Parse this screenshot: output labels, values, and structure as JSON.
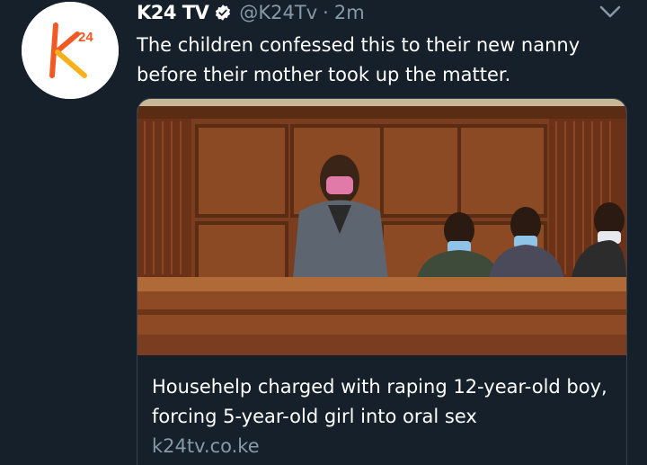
{
  "tweet": {
    "display_name": "K24 TV",
    "handle": "@K24Tv",
    "separator": "·",
    "time": "2m",
    "text": "The children confessed this to their new nanny\nbefore their mother took up the matter.",
    "avatar_logo_text": "k24",
    "icons": {
      "verified": "verified-badge-icon",
      "caret": "chevron-down-icon"
    }
  },
  "card": {
    "title": "Househelp charged with raping 12-year-old boy, forcing 5-year-old girl into oral sex",
    "domain": "k24tv.co.ke",
    "image_description_icon": "courtroom-photo"
  },
  "colors": {
    "background": "#15202b",
    "secondary_text": "#8899a6",
    "border": "#38444d",
    "brand_orange": "#f15a24",
    "brand_yellow": "#f7b11c"
  }
}
